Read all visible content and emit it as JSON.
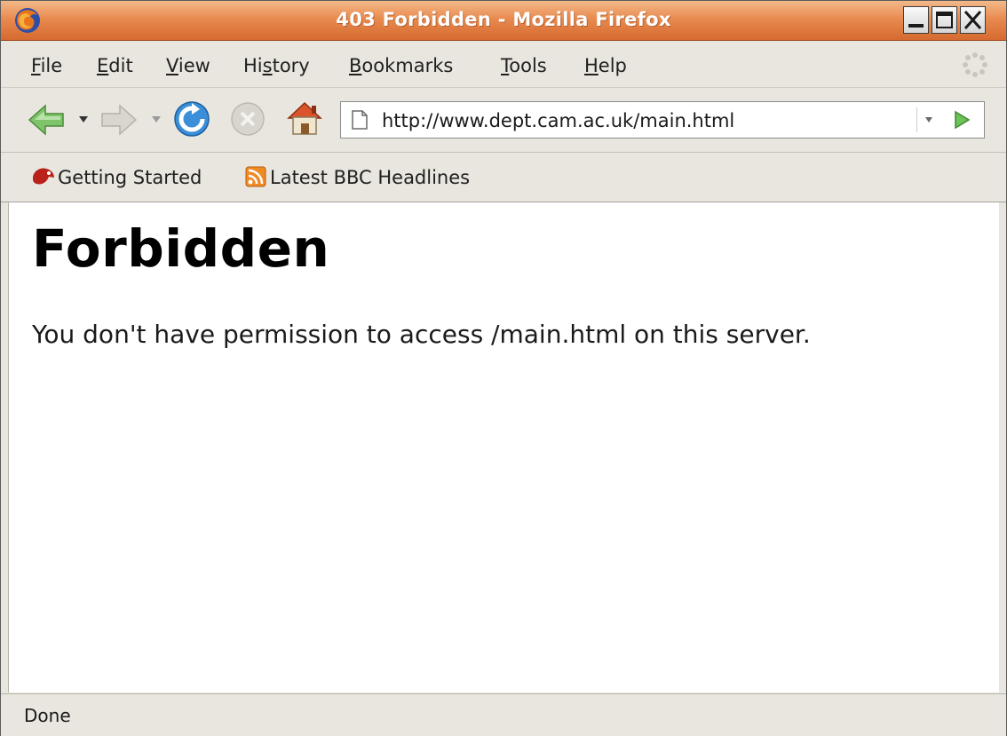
{
  "window": {
    "title": "403 Forbidden - Mozilla Firefox"
  },
  "menu": {
    "items": [
      {
        "label": "File",
        "accel": "F",
        "rest": "ile"
      },
      {
        "label": "Edit",
        "accel": "E",
        "rest": "dit"
      },
      {
        "label": "View",
        "accel": "V",
        "rest": "iew"
      },
      {
        "label": "History",
        "pre": "Hi",
        "accel": "s",
        "rest": "tory"
      },
      {
        "label": "Bookmarks",
        "accel": "B",
        "rest": "ookmarks"
      },
      {
        "label": "Tools",
        "accel": "T",
        "rest": "ools"
      },
      {
        "label": "Help",
        "accel": "H",
        "rest": "elp"
      }
    ]
  },
  "navigation": {
    "url": "http://www.dept.cam.ac.uk/main.html",
    "icons": [
      "back-arrow-icon",
      "forward-arrow-icon",
      "reload-icon",
      "stop-icon",
      "home-icon",
      "go-arrow-icon"
    ]
  },
  "bookmarks": {
    "items": [
      {
        "label": "Getting Started",
        "icon": "firefox-bookmark-icon"
      },
      {
        "label": "Latest BBC Headlines",
        "icon": "rss-feed-icon"
      }
    ]
  },
  "page": {
    "heading": "Forbidden",
    "message": "You don't have permission to access /main.html on this server."
  },
  "status": {
    "text": "Done"
  },
  "colors": {
    "titlebar": "#e98b50",
    "chrome": "#e9e6df",
    "content_bg": "#ffffff"
  }
}
